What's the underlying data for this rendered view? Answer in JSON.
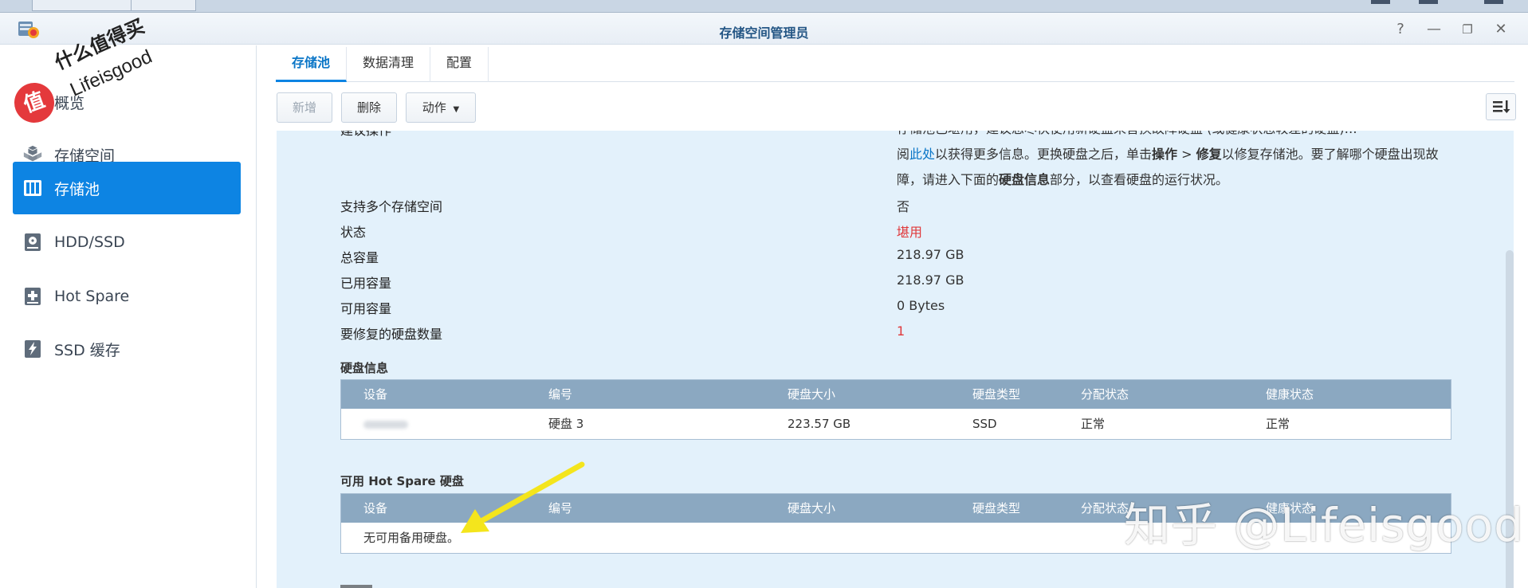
{
  "window": {
    "title": "存储空间管理员",
    "controls": [
      "?",
      "—",
      "❐",
      "✕"
    ]
  },
  "watermark": {
    "badge": "值",
    "line1": "什么值得买",
    "line2": "Lifeisgood",
    "zhihu": "知乎 @Lifeisgood"
  },
  "sidebar": {
    "items": [
      {
        "label": "概览",
        "icon": "overview-icon"
      },
      {
        "label": "存储空间",
        "icon": "volume-cubes-icon"
      },
      {
        "label": "存储池",
        "icon": "storage-pool-icon",
        "active": true
      },
      {
        "label": "HDD/SSD",
        "icon": "disk-icon"
      },
      {
        "label": "Hot Spare",
        "icon": "hot-spare-plus-icon"
      },
      {
        "label": "SSD 缓存",
        "icon": "ssd-cache-bolt-icon"
      }
    ]
  },
  "tabs": [
    {
      "label": "存储池",
      "active": true
    },
    {
      "label": "数据清理"
    },
    {
      "label": "配置"
    }
  ],
  "toolbar": {
    "add": "新增",
    "delete": "删除",
    "action": "动作"
  },
  "info": {
    "truncated_label": "建议操作",
    "truncated_text": "存储池已堪用，建议您尽快使用新硬盘来替换故障硬盘 (或健康状态较差的硬盘)…",
    "desc_line1_pre": "阅",
    "desc_link": "此处",
    "desc_line1_post": "以获得更多信息。更换硬盘之后，单击",
    "desc_op": "操作",
    "desc_gt": " > ",
    "desc_repair": "修复",
    "desc_line1_end": "以修复存储池。要了解哪个硬盘出现故",
    "desc_line2_pre": "障，请进入下面的",
    "desc_diskinfo": "硬盘信息",
    "desc_line2_post": "部分，以查看硬盘的运行状况。",
    "rows": [
      {
        "label": "支持多个存储空间",
        "value": "否"
      },
      {
        "label": "状态",
        "value": "堪用"
      },
      {
        "label": "总容量",
        "value": "218.97 GB"
      },
      {
        "label": "已用容量",
        "value": "218.97 GB"
      },
      {
        "label": "可用容量",
        "value": "0 Bytes"
      },
      {
        "label": "要修复的硬盘数量",
        "value": "1"
      }
    ]
  },
  "disk_info": {
    "title": "硬盘信息",
    "columns": [
      "设备",
      "编号",
      "硬盘大小",
      "硬盘类型",
      "分配状态",
      "健康状态"
    ],
    "rows": [
      {
        "device": "",
        "number": "硬盘 3",
        "size": "223.57 GB",
        "type": "SSD",
        "alloc": "正常",
        "health": "正常"
      }
    ]
  },
  "hot_spare": {
    "title": "可用 Hot Spare 硬盘",
    "columns": [
      "设备",
      "编号",
      "硬盘大小",
      "硬盘类型",
      "分配状态",
      "健康状态"
    ],
    "empty": "无可用备用硬盘。"
  },
  "colors": {
    "accent": "#0d84e3",
    "panel_bg": "#e3f1fb",
    "table_header": "#8ba8c1",
    "danger": "#e0383a",
    "ok": "#3b9d2e",
    "arrow": "#f4e51c"
  }
}
